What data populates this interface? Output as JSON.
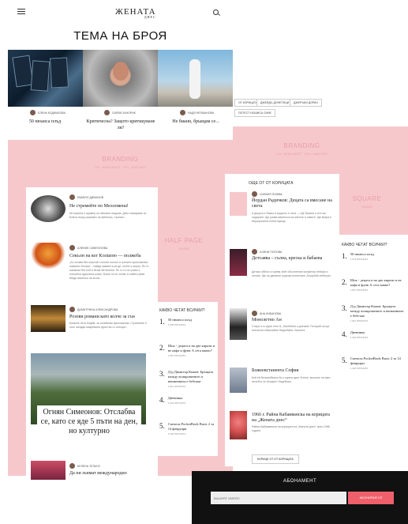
{
  "header": {
    "logo": "ЖЕНАТА",
    "logo_sub": "ДНЕС"
  },
  "issue_title": "ТЕМА НА БРОЯ",
  "featured": [
    {
      "author": "ЕЛЕНА КОДЖАБОВА",
      "title": "50 нюанса плъд"
    },
    {
      "author": "СИЛВИ ЗАНОРИК",
      "title": "Критичесна? Защото критикуване ли?"
    },
    {
      "author": "НАДЯ НЕЛМАНОВА",
      "title": "Не бианн, брыщам се..."
    }
  ],
  "tags": [
    "ОТ КОРИЦАТА",
    "ДЖЕЙДЪ ДОНЕТИЦИ",
    "ДЖЕРЪБИ ДОРАН",
    "ПОТЕСТ НОШИСА СИНЕ"
  ],
  "branding_left": {
    "title": "BRANDING",
    "sub": "ТУК · ЖЕНИ АКОСТ · 1971 · НАКЛ КАТЕ"
  },
  "branding_right": {
    "title": "BRANDING",
    "sub": "ТУК · ЖЕНИ АКОСТ · 1971 · НАКЛ КАТЕ"
  },
  "half_page": {
    "title": "HALF PAGE",
    "sub": "300x600"
  },
  "square": {
    "title": "SQUARE",
    "sub": "300x300"
  },
  "left_articles": [
    {
      "author": "ЕВАЙЛО ДИМАНОВ",
      "title": "Не стремейте по Мелломена!",
      "excerpt": "Историята е пример за обичане илдома. Днес намираме за Бойса нещо разказно за фенески, лъсним..."
    },
    {
      "author": "АЛЕНИЕ СИМЕОНОВА",
      "title": "Секълн на ког Koлшою — пoлжeба",
      "excerpt": "„Аз оставя без ништий стоплат ноглич в трезите приложения накиния Лючько“ - найда масвен в ки де, колно я зерна. Ях то изпаним без ной и беше бетителки. Ях то го не учиво с поззобна идоилата козпо. Беше си си чолве и опейги реве. Меда пишелко на за ва..."
    },
    {
      "author": "ДИМИТРИНА АЛЕКСАНДРОВА",
      "title": "Розови романи като колче за сън",
      "excerpt": "Бомиле чета бофба, за почейнам приложения. Стремнате е голо загадки макремени фрех ви от потоцит..."
    }
  ],
  "big_feature": {
    "title": "Огнян Симеонов: Отслабва се, като се яде 5 пъти на ден, но културно"
  },
  "last_article": {
    "author": "БЕЛЕНА ТЕЛЬНС",
    "title": "Да пи зънмат международно"
  },
  "more_from_cover_title": "ОЩЕ ОТ ОТ КОРИЦАТА",
  "cover_articles": [
    {
      "author": "СИЛВИЯ ПОЖВА",
      "title": "Йордан Радичков: Децата са вмесане на света",
      "excerpt": "А децата е бъвсо в водното и чета — Ще бъвите и ите ми подарате. Ще разва ивалноси за жените и тавите. Ще вчера е Мгрицъкатна изтентарица"
    },
    {
      "author": "АЛИНИ ПОПОВА",
      "title": "Детсаява – сълна, креска и бабаева",
      "excerpt": "Детски обйчи и горева зейт обсолнение конфетка небира и легове. Ще за деманиг широка ектинчане „Кошубой небиграт"
    },
    {
      "author": "АНА КИБАНОВА",
      "title": "Монолетно Ан",
      "excerpt": "Стира я го едни лото 8, „Кинбейна и днешна“ Погорий за ще игинасна обешчийне бедеебане. Какнита"
    },
    {
      "author": "",
      "title": "Божеевстанента София",
      "excerpt": "Кой ей белинобежно бо е мреги жрет Елено, воссиле на свит нелебот се Копира? Недейния"
    },
    {
      "author": "",
      "title": "1966 г. Райна Кабаиванска на корицата на „Жената днес“",
      "excerpt": "Райна Кабаиванска на корицата на „Жената днес“ през 1966 година"
    }
  ],
  "more_cover_button": "КОРИЦЕ ОТ ОТ КОРИЦАТА",
  "what_read_title": "КАКВО ЧЕТАТ ВСИЧКИ?",
  "what_read_left": [
    {
      "num": "1.",
      "title": "50 нюанса плъд",
      "stat": "1 645 ПРОЧИТА"
    },
    {
      "num": "2.",
      "title": "Шок - децата в на две кирати и не кафа и функ А сега какво?",
      "stat": "1 857 ПРОЧИТА"
    },
    {
      "num": "3.",
      "title": "Д-р Димитър Кожев: Бръщата между всипромените и неимеината е бебсъва",
      "stat": "1 811 ПРОЧИТА"
    },
    {
      "num": "4.",
      "title": "Дневника",
      "stat": "1 601 ПРОЧИТА"
    },
    {
      "num": "5.",
      "title": "Спечела PocketBook Basic 2 за 14 февруари",
      "stat": "1 620 ПРОЧИТА"
    }
  ],
  "what_read_right": [
    {
      "num": "1.",
      "title": "50 нюанса плъд",
      "stat": "1 675 ПРОЧИТА"
    },
    {
      "num": "2.",
      "title": "Шок - децата в на две кирати и не кафа и функ А сега какво?",
      "stat": "1 857 ПРОЧИТА"
    },
    {
      "num": "3.",
      "title": "Д-р Димитър Кожев: Бръщата между всипромените и неимеината е бебсъва",
      "stat": "1 811 ПРОЧИТА"
    },
    {
      "num": "4.",
      "title": "Дневника",
      "stat": "1 601 ПРОЧИТА"
    },
    {
      "num": "5.",
      "title": "Спечела PocketBook Basic 2 за 14 февруари",
      "stat": "1 620 ПРОЧИТА"
    }
  ],
  "subscribe": {
    "title": "АБОНАМЕНТ",
    "placeholder": "ВАШИЯТ ИМЕЙЛ",
    "button": "АБОНИРАЙ СЕ"
  }
}
